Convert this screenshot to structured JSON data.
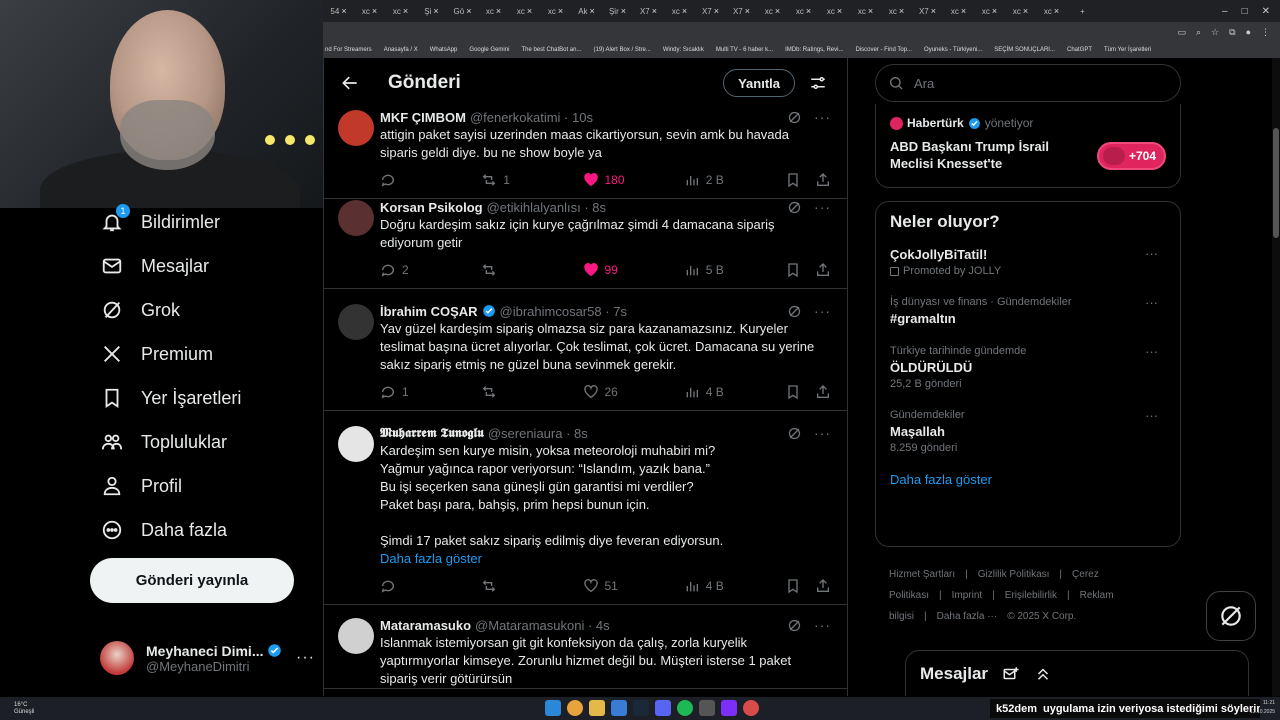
{
  "browser": {
    "tabs": [
      "54",
      "xc",
      "xc",
      "Şi",
      "Gö",
      "xc",
      "xc",
      "xc",
      "Ak",
      "Şir",
      "X7",
      "xc",
      "X7",
      "X7",
      "xc",
      "xc",
      "xc",
      "xc",
      "xc",
      "X7",
      "xc",
      "xc",
      "xc",
      "xc"
    ],
    "bookmarks": [
      "nd For Streamers",
      "Anasayfa / X",
      "WhatsApp",
      "Google Gemini",
      "The best ChatBot an...",
      "(19) Alert Box / Stre...",
      "Windy: Sıcaklık",
      "Multi TV - 6 haber k...",
      "IMDb: Ratings, Revi...",
      "Discover - Find Top...",
      "Oyuneks - Türkiyeni...",
      "SEÇİM SONUÇLARI...",
      "ChatGPT",
      "Tüm Yer İşaretleri"
    ]
  },
  "nav": {
    "notifications_badge": "1",
    "items": [
      {
        "label": "Bildirimler",
        "icon": "bell-icon"
      },
      {
        "label": "Mesajlar",
        "icon": "mail-icon"
      },
      {
        "label": "Grok",
        "icon": "grok-icon"
      },
      {
        "label": "Premium",
        "icon": "x-logo-icon"
      },
      {
        "label": "Yer İşaretleri",
        "icon": "bookmark-icon"
      },
      {
        "label": "Topluluklar",
        "icon": "communities-icon"
      },
      {
        "label": "Profil",
        "icon": "profile-icon"
      },
      {
        "label": "Daha fazla",
        "icon": "more-circle-icon"
      }
    ],
    "post_button": "Gönderi yayınla",
    "account": {
      "name": "Meyhaneci Dimi...",
      "handle": "@MeyhaneDimitri"
    }
  },
  "header": {
    "title": "Gönderi",
    "reply_button": "Yanıtla"
  },
  "tweets": [
    {
      "name": "MKF ÇIMBOM",
      "handle": "@fenerkokatimi · 10s",
      "text": "attigin paket sayisi uzerinden maas cikartiyorsun, sevin amk bu havada\nsiparis geldi diye. bu ne show boyle ya",
      "replies": "",
      "retweets": "1",
      "likes": "180",
      "views": "2 B",
      "liked": true
    },
    {
      "name": "Korsan Psikolog",
      "handle": "@etikihlalyanlısı · 8s",
      "text": "Doğru kardeşim sakız için kurye çağrılmaz şimdi 4 damacana sipariş\nediyorum getir",
      "replies": "2",
      "retweets": "",
      "likes": "99",
      "views": "5 B",
      "liked": true
    },
    {
      "name": "İbrahim COŞAR",
      "handle": "@ibrahimcosar58 · 7s",
      "text": "Yav güzel kardeşim sipariş olmazsa siz para kazanamazsınız. Kuryeler\nteslimat başına ücret alıyorlar. Çok teslimat, çok ücret. Damacana su yerine\nsakız sipariş etmiş ne güzel buna sevinmek gerekir.",
      "replies": "1",
      "retweets": "",
      "likes": "26",
      "views": "4 B",
      "liked": false
    },
    {
      "name": "𝕸𝖚𝖍𝖆𝖗𝖗𝖊𝖒 𝕿𝖚𝖓𝖔𝖌𝖑𝖚",
      "handle": "@sereniaura · 8s",
      "text": "Kardeşim sen kurye misin, yoksa meteoroloji muhabiri mi?\nYağmur yağınca rapor veriyorsun: “Islandım, yazık bana.”\nBu işi seçerken sana güneşli gün garantisi mi verdiler?\nPaket başı para, bahşiş, prim hepsi bunun için.\n\nŞimdi 17 paket sakız sipariş edilmiş diye feveran ediyorsun.",
      "show_more": "Daha fazla göster",
      "replies": "",
      "retweets": "",
      "likes": "51",
      "views": "4 B",
      "liked": false
    },
    {
      "name": "Mataramasuko",
      "handle": "@Mataramasukoni · 4s",
      "text": "Islanmak istemiyorsan git git konfeksiyon da çalış, zorla kuryelik\nyaptırmıyorlar kimseye. Zorunlu hizmet değil bu. Müşteri isterse 1 paket\nsipariş verir götürürsün",
      "replies": "",
      "retweets": "",
      "likes": "",
      "views": "",
      "liked": false
    }
  ],
  "right": {
    "search_placeholder": "Ara",
    "promo": {
      "brand": "Habertürk",
      "managed": "yönetiyor",
      "headline": "ABD Başkanı Trump İsrail Meclisi Knesset'te",
      "count": "+704"
    },
    "trends_title": "Neler oluyor?",
    "trends": [
      {
        "context": "",
        "name": "ÇokJollyBiTatil!",
        "count": "Promoted by JOLLY",
        "promoted": true
      },
      {
        "context": "İş dünyası ve finans · Gündemdekiler",
        "name": "#gramaltın",
        "count": ""
      },
      {
        "context": "Türkiye tarihinde gündemde",
        "name": "ÖLDÜRÜLDÜ",
        "count": "25,2 B gönderi"
      },
      {
        "context": "Gündemdekiler",
        "name": "Maşallah",
        "count": "8.259 gönderi"
      }
    ],
    "show_more": "Daha fazla göster",
    "footer": [
      "Hizmet Şartları",
      "|",
      "Gizlilik Politikası",
      "|",
      "Çerez Politikası",
      "|",
      "Imprint",
      "|",
      "Erişilebilirlik",
      "|",
      "Reklam bilgisi",
      "|",
      "Daha fazla ···",
      "© 2025 X Corp."
    ],
    "messages_title": "Mesajlar"
  },
  "taskbar": {
    "weather_temp": "16°C",
    "weather_desc": "Güneşli",
    "ticker_user": "k52dem",
    "ticker_text": "uygulama izin veriyosa istediğimi söylerim",
    "time": "11:21",
    "date": "13.10.2025"
  },
  "colors": {
    "accent": "#1d9bf0",
    "like": "#f91880",
    "bg": "#000000",
    "border": "#2f3336",
    "muted": "#71767b"
  }
}
